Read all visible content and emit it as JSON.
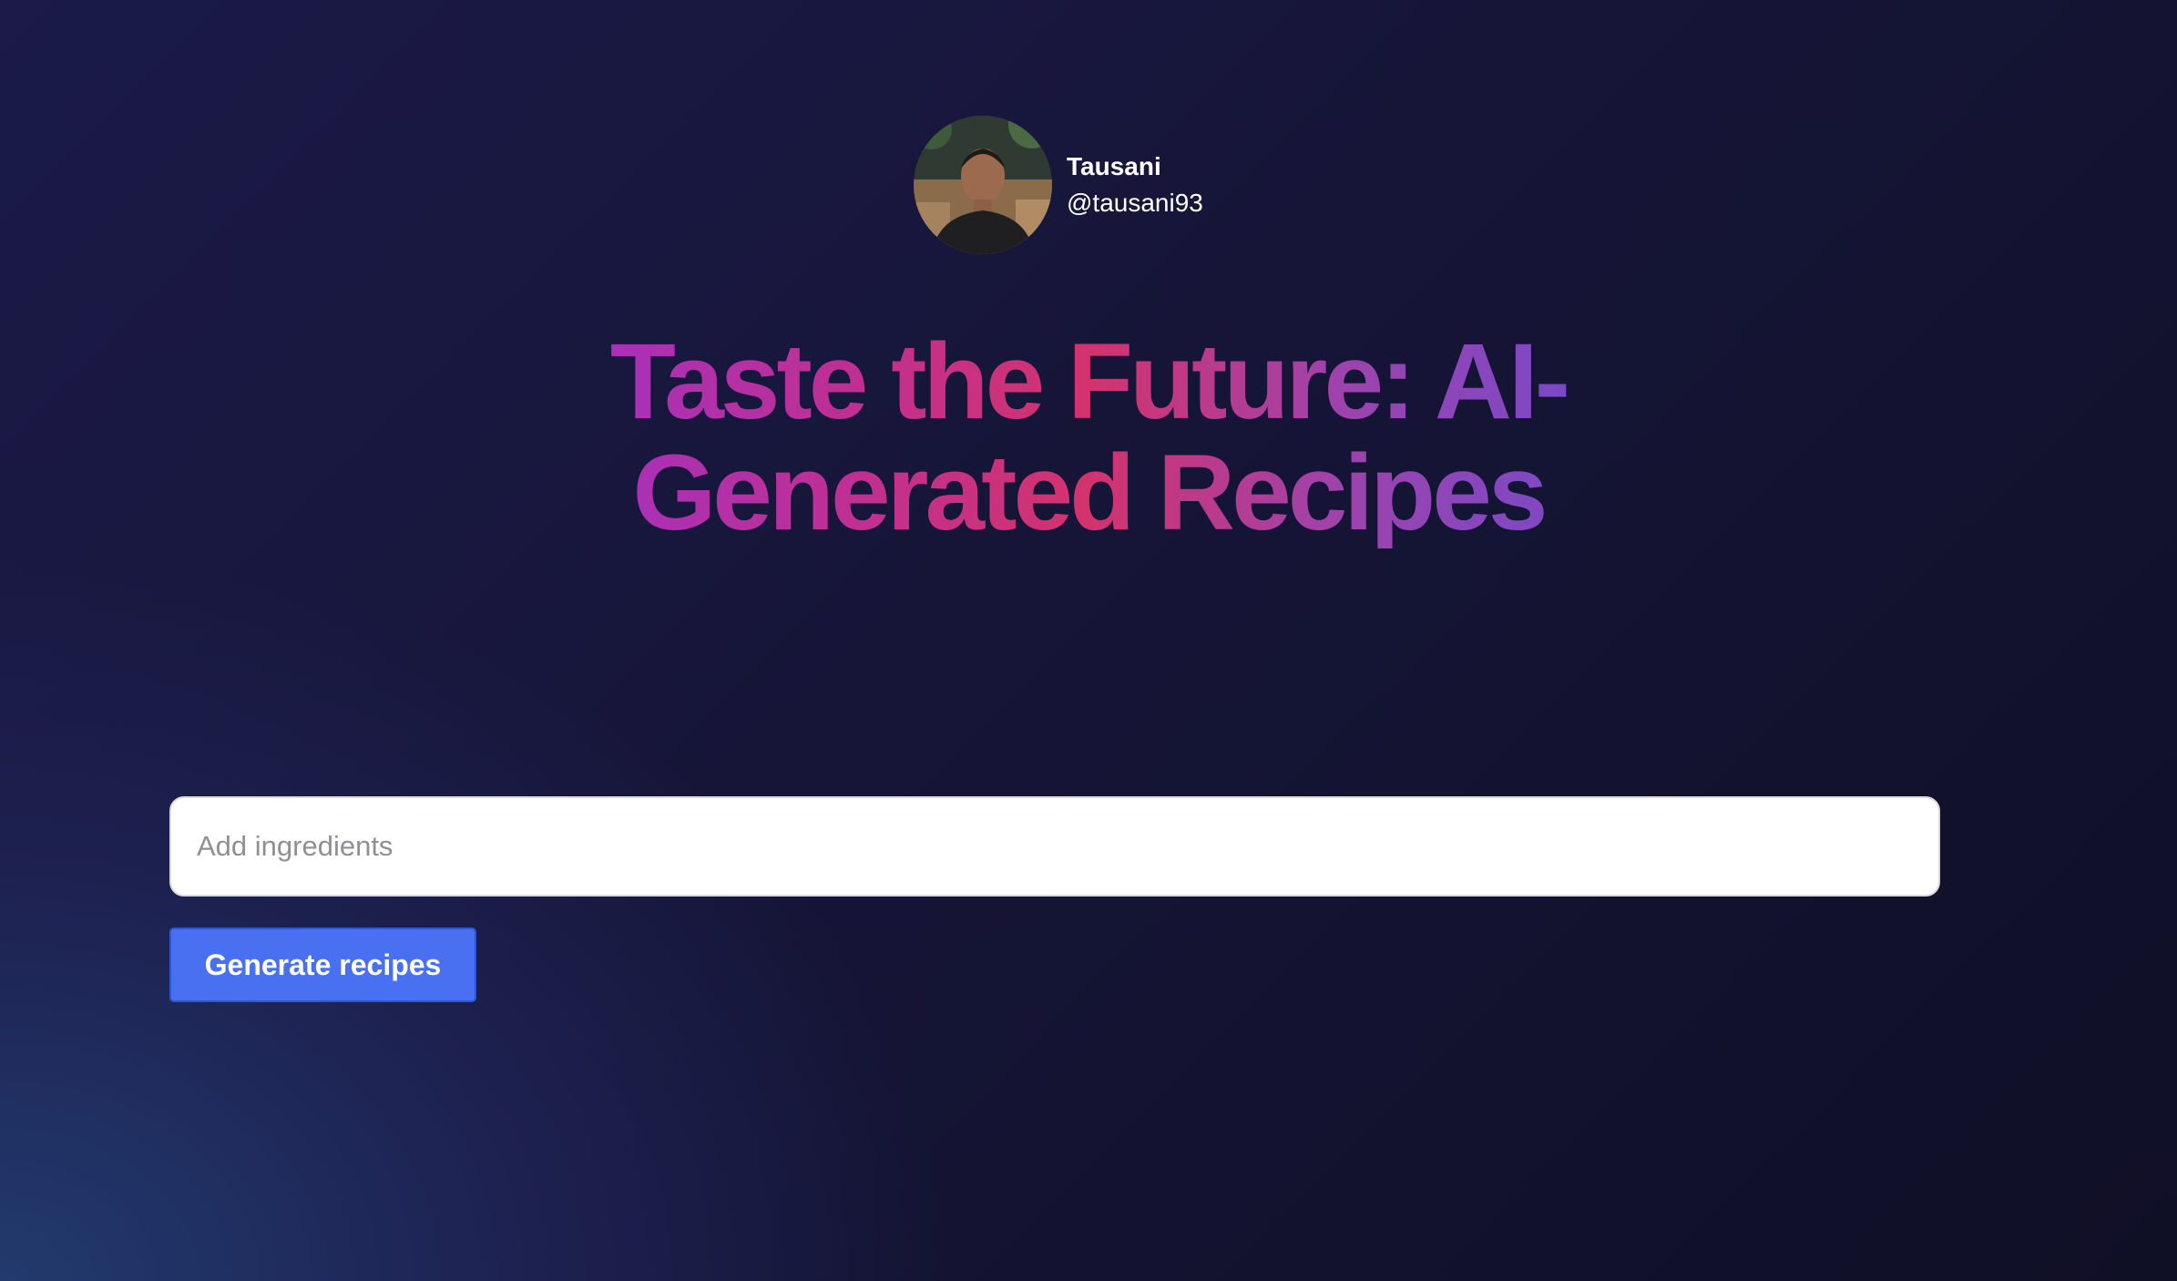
{
  "profile": {
    "name": "Tausani",
    "handle": "@tausani93"
  },
  "hero": {
    "title": "Taste the Future: AI-Generated Recipes"
  },
  "form": {
    "ingredients_placeholder": "Add ingredients",
    "ingredients_value": "",
    "generate_label": "Generate recipes"
  },
  "colors": {
    "button": "#4a70f2",
    "title_gradient": [
      "#9d32c9",
      "#d3336d",
      "#6b4cd1"
    ]
  }
}
